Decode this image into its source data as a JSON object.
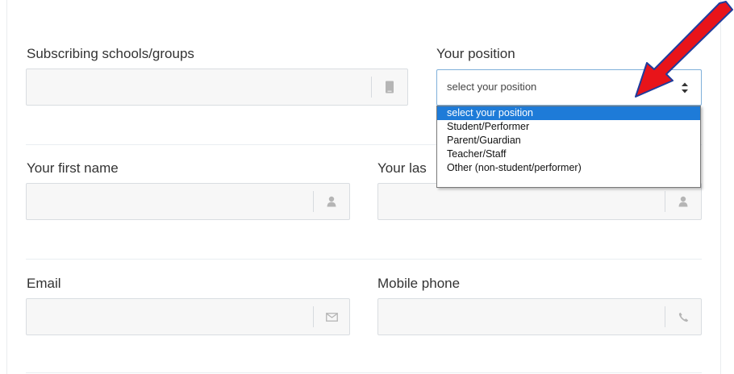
{
  "form": {
    "schools_label": "Subscribing schools/groups",
    "position_label": "Your position",
    "first_name_label": "Your first name",
    "last_name_label": "Your las",
    "email_label": "Email",
    "mobile_label": "Mobile phone",
    "schools_value": "",
    "first_name_value": "",
    "last_name_value": "",
    "email_value": "",
    "mobile_value": ""
  },
  "position_select": {
    "selected": "select your position",
    "options": [
      "select your position",
      "Student/Performer",
      "Parent/Guardian",
      "Teacher/Staff",
      "Other (non-student/performer)"
    ],
    "highlighted_index": 0
  },
  "icons": {
    "schools": "tablet-icon",
    "first_name": "user-icon",
    "last_name": "user-icon",
    "email": "envelope-icon",
    "mobile": "phone-icon",
    "select": "up-down-arrows-icon",
    "annotation": "red-arrow"
  },
  "colors": {
    "input_bg": "#f7f7f7",
    "input_border": "#d9dde1",
    "select_border": "#7fb0da",
    "highlight": "#1e7bd8",
    "annotation_red": "#e8141a",
    "annotation_outline": "#1f3c9c"
  }
}
